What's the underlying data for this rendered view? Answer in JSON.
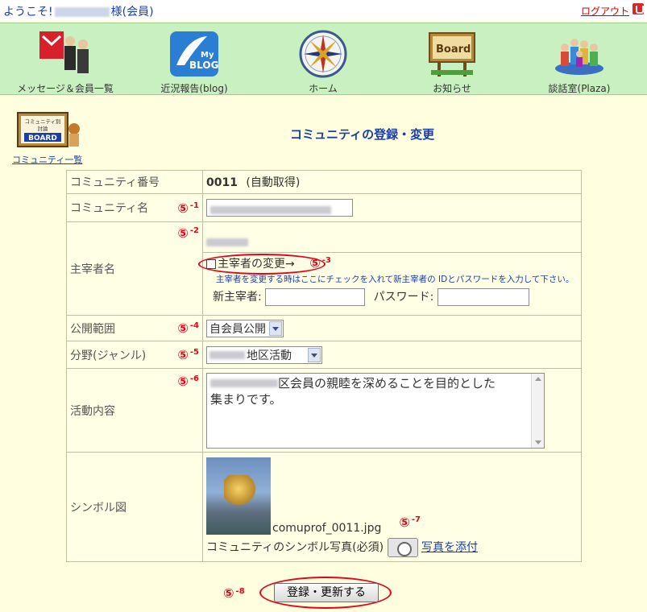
{
  "header": {
    "welcome_prefix": "ようこそ!",
    "welcome_suffix": "様(会員)",
    "logout": "ログアウト"
  },
  "nav": [
    {
      "label": "メッセージ＆会員一覧",
      "icon": "message-members-icon"
    },
    {
      "label": "近況報告(blog)",
      "icon": "blog-icon",
      "badge_top": "My",
      "badge_bottom": "BLOG"
    },
    {
      "label": "ホーム",
      "icon": "compass-icon"
    },
    {
      "label": "お知らせ",
      "icon": "board-icon",
      "sign": "Board"
    },
    {
      "label": "談話室(Plaza)",
      "icon": "plaza-icon"
    }
  ],
  "side": {
    "logo_line1": "コミュニティ別",
    "logo_line2": "討論",
    "logo_line3": "BOARD",
    "link": "コミュニティ一覧"
  },
  "page_title": "コミュニティの登録・変更",
  "form": {
    "community_no_label": "コミュニティ番号",
    "community_no_value": "0011",
    "community_no_note": "(自動取得)",
    "community_name_label": "コミュニティ名",
    "host_label": "主宰者名",
    "host_change_label": "主宰者の変更→",
    "host_note": "主宰者を変更する時はここにチェックを入れて新主宰者の IDとパスワードを入力して下さい。",
    "new_host_label": "新主宰者:",
    "password_label": "パスワード:",
    "scope_label": "公開範囲",
    "scope_value": "自会員公開",
    "genre_label": "分野(ジャンル)",
    "genre_value": "地区活動",
    "activity_label": "活動内容",
    "activity_line1": "区会員の親睦を深めることを目的とした",
    "activity_line2": "集まりです。",
    "symbol_label": "シンボル図",
    "symbol_filename": "comuprof_0011.jpg",
    "symbol_caption": "コミュニティのシンボル写真(必須)",
    "attach_link": "写真を添付"
  },
  "markers": {
    "m1": "-1",
    "m2": "-2",
    "m3": "-3",
    "m4": "-4",
    "m5": "-5",
    "m6": "-6",
    "m7": "-7",
    "m8": "-8",
    "circle": "⑤"
  },
  "submit_label": "登録・更新する",
  "colors": {
    "nav_bg": "#c8f0c0",
    "page_bg": "#ffffe0",
    "link": "#1a3ea8",
    "annotation": "#e8001a"
  }
}
